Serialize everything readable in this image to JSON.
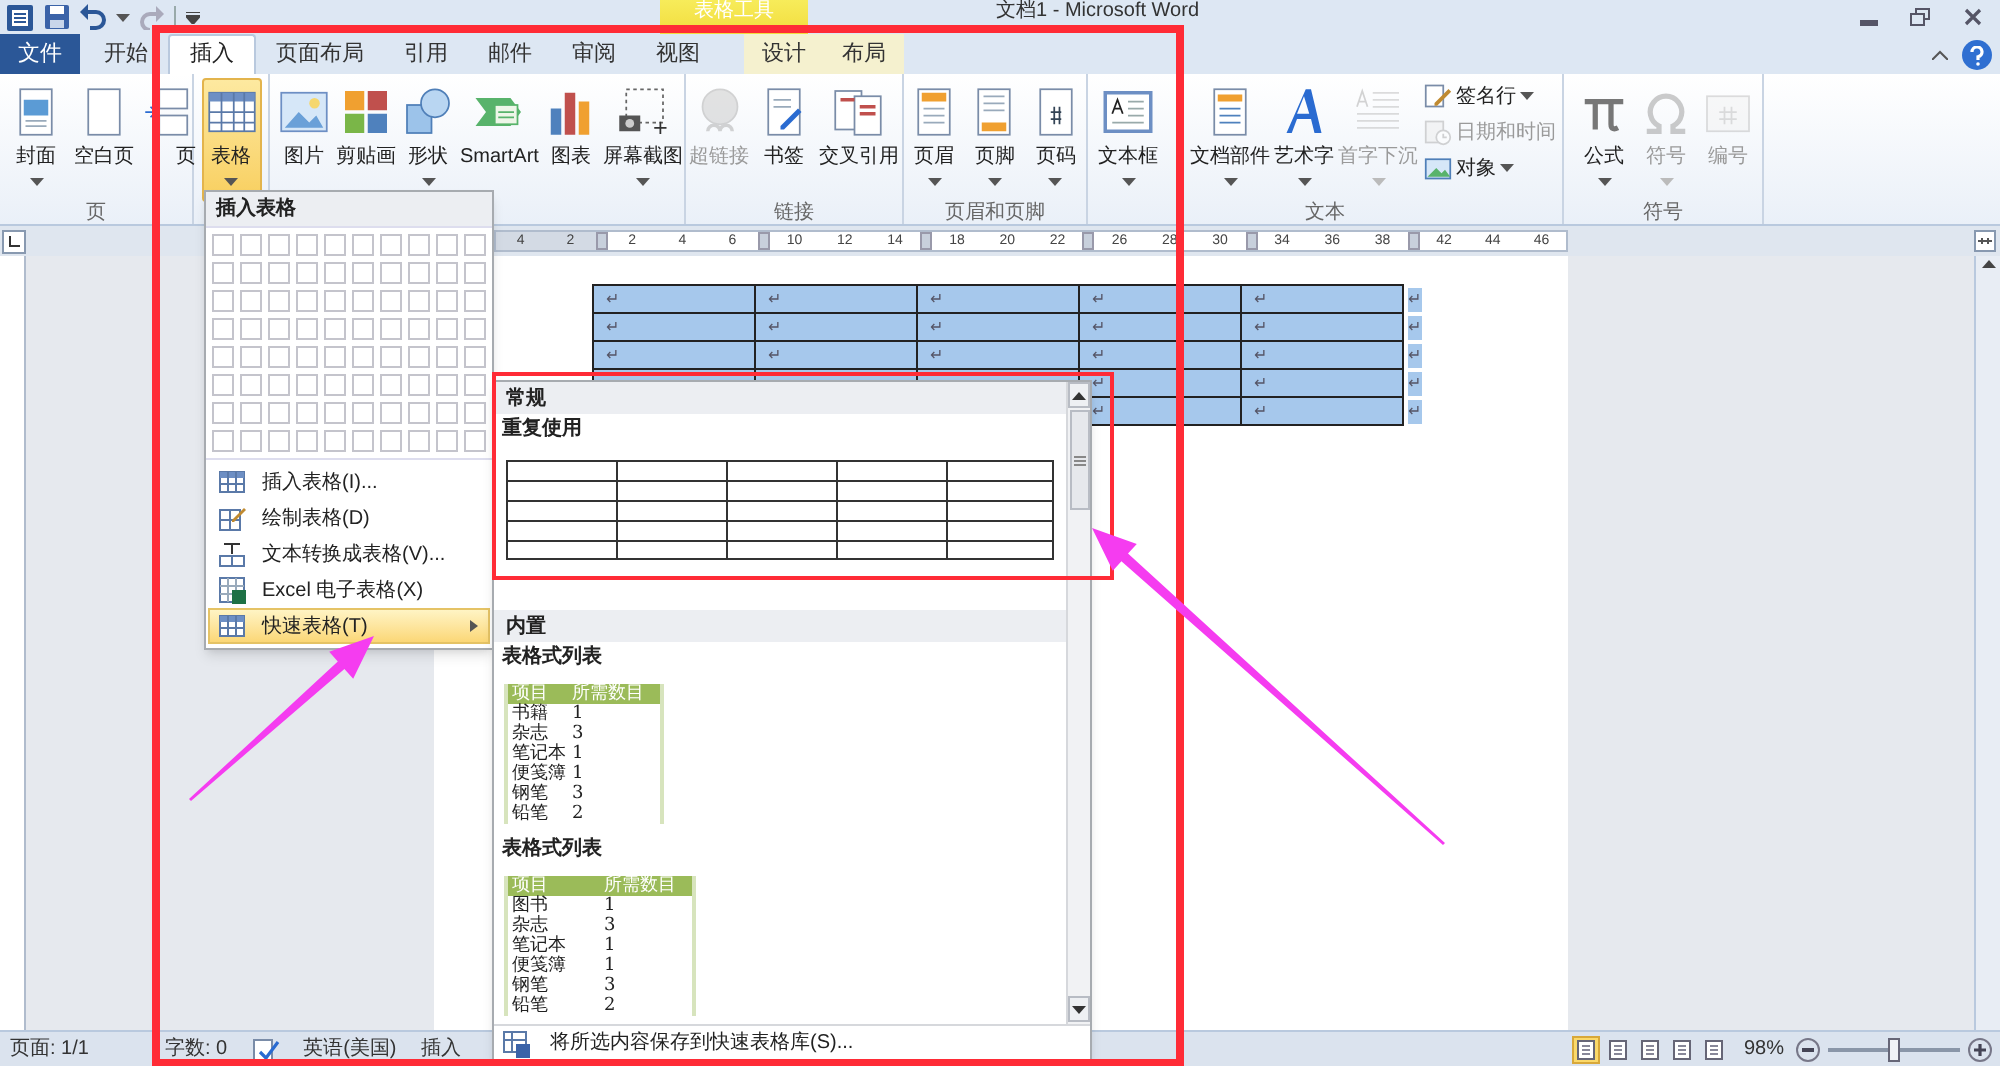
{
  "title_bar": {
    "context_header": "表格工具",
    "title": "文档1 - Microsoft Word"
  },
  "tabs": [
    {
      "label": "文件",
      "kind": "file",
      "selected": false
    },
    {
      "label": "开始",
      "kind": "normal",
      "selected": false
    },
    {
      "label": "插入",
      "kind": "normal",
      "selected": true
    },
    {
      "label": "页面布局",
      "kind": "normal",
      "selected": false
    },
    {
      "label": "引用",
      "kind": "normal",
      "selected": false
    },
    {
      "label": "邮件",
      "kind": "normal",
      "selected": false
    },
    {
      "label": "审阅",
      "kind": "normal",
      "selected": false
    },
    {
      "label": "视图",
      "kind": "normal",
      "selected": false
    },
    {
      "label": "设计",
      "kind": "context",
      "selected": false
    },
    {
      "label": "布局",
      "kind": "context",
      "selected": false
    }
  ],
  "ribbon": {
    "groups": [
      {
        "label": "页",
        "buttons": [
          {
            "label": "封面",
            "kind": "large",
            "has_menu": true,
            "disabled": false,
            "pressed": false
          },
          {
            "label": "空白页",
            "kind": "large",
            "has_menu": false,
            "disabled": false,
            "pressed": false
          },
          {
            "label": "页",
            "kind": "large",
            "has_menu": false,
            "disabled": false,
            "pressed": false
          }
        ]
      },
      {
        "buttons": [
          {
            "label": "表格",
            "kind": "large",
            "has_menu": true,
            "disabled": false,
            "pressed": true
          }
        ]
      },
      {
        "buttons": [
          {
            "label": "图片",
            "kind": "large",
            "has_menu": false,
            "disabled": false,
            "pressed": false
          },
          {
            "label": "剪贴画",
            "kind": "large",
            "has_menu": false,
            "disabled": false,
            "pressed": false
          },
          {
            "label": "形状",
            "kind": "large",
            "has_menu": true,
            "disabled": false,
            "pressed": false
          },
          {
            "label": "SmartArt",
            "kind": "large",
            "has_menu": false,
            "disabled": false,
            "pressed": false
          },
          {
            "label": "图表",
            "kind": "large",
            "has_menu": false,
            "disabled": false,
            "pressed": false
          },
          {
            "label": "屏幕截图",
            "kind": "large",
            "has_menu": true,
            "disabled": false,
            "pressed": false
          }
        ]
      },
      {
        "label": "链接",
        "buttons": [
          {
            "label": "超链接",
            "kind": "large",
            "has_menu": false,
            "disabled": true,
            "pressed": false
          },
          {
            "label": "书签",
            "kind": "large",
            "has_menu": false,
            "disabled": false,
            "pressed": false
          },
          {
            "label": "交叉引用",
            "kind": "large",
            "has_menu": false,
            "disabled": false,
            "pressed": false
          }
        ]
      },
      {
        "label": "页眉和页脚",
        "buttons": [
          {
            "label": "页眉",
            "kind": "large",
            "has_menu": true,
            "disabled": false,
            "pressed": false
          },
          {
            "label": "页脚",
            "kind": "large",
            "has_menu": true,
            "disabled": false,
            "pressed": false
          },
          {
            "label": "页码",
            "kind": "large",
            "has_menu": true,
            "disabled": false,
            "pressed": false
          }
        ]
      },
      {
        "label": "文本",
        "buttons": [
          {
            "label": "文本框",
            "kind": "large",
            "has_menu": true,
            "disabled": false,
            "pressed": false
          },
          {
            "label": "文档部件",
            "kind": "large",
            "has_menu": true,
            "disabled": false,
            "pressed": false
          },
          {
            "label": "艺术字",
            "kind": "large",
            "has_menu": true,
            "disabled": false,
            "pressed": false
          },
          {
            "label": "首字下沉",
            "kind": "large",
            "has_menu": true,
            "disabled": true,
            "pressed": false
          },
          {
            "label": "签名行",
            "kind": "small",
            "has_menu": true,
            "disabled": false,
            "pressed": false
          },
          {
            "label": "日期和时间",
            "kind": "small",
            "has_menu": false,
            "disabled": true,
            "pressed": false
          },
          {
            "label": "对象",
            "kind": "small",
            "has_menu": true,
            "disabled": false,
            "pressed": false
          }
        ]
      },
      {
        "label": "符号",
        "buttons": [
          {
            "label": "公式",
            "kind": "large",
            "has_menu": true,
            "disabled": false,
            "pressed": false
          },
          {
            "label": "符号",
            "kind": "large",
            "has_menu": true,
            "disabled": true,
            "pressed": false
          },
          {
            "label": "编号",
            "kind": "large",
            "has_menu": false,
            "disabled": true,
            "pressed": false
          }
        ]
      }
    ]
  },
  "ruler": {
    "segments": [
      {
        "labels": [
          "4",
          "2"
        ]
      },
      {
        "labels": [
          "2",
          "4",
          "6"
        ]
      },
      {
        "labels": [
          "10",
          "12",
          "14"
        ]
      },
      {
        "labels": [
          "18",
          "20",
          "22"
        ]
      },
      {
        "labels": [
          "26",
          "28",
          "30"
        ]
      },
      {
        "labels": [
          "34",
          "36",
          "38"
        ]
      },
      {
        "labels": [
          "42",
          "44",
          "46"
        ]
      }
    ]
  },
  "document_table": {
    "rows": [
      {
        "selected": true,
        "cells": [
          "↵",
          "↵",
          "↵",
          "↵",
          "↵"
        ],
        "end": "↵"
      },
      {
        "selected": true,
        "cells": [
          "↵",
          "↵",
          "↵",
          "↵",
          "↵"
        ],
        "end": "↵"
      },
      {
        "selected": true,
        "cells": [
          "↵",
          "↵",
          "↵",
          "↵",
          "↵"
        ],
        "end": "↵"
      },
      {
        "selected": true,
        "cells": [
          "↵",
          "↵"
        ],
        "end": "↵"
      },
      {
        "selected": true,
        "cells": [
          "↵",
          "↵"
        ],
        "end": "↵"
      }
    ]
  },
  "table_menu": {
    "header": "插入表格",
    "items": [
      {
        "label": "插入表格(I)...",
        "highlighted": false,
        "has_submenu": false
      },
      {
        "label": "绘制表格(D)",
        "highlighted": false,
        "has_submenu": false
      },
      {
        "label": "文本转换成表格(V)...",
        "highlighted": false,
        "has_submenu": false
      },
      {
        "label": "Excel 电子表格(X)",
        "highlighted": false,
        "has_submenu": false
      },
      {
        "label": "快速表格(T)",
        "highlighted": true,
        "has_submenu": true
      }
    ]
  },
  "quick_tables": {
    "sections": [
      {
        "header": "常规",
        "entries": [
          {
            "kind": "grid",
            "label": "重复使用"
          }
        ]
      },
      {
        "header": "内置",
        "entries": [
          {
            "kind": "list",
            "label": "表格式列表",
            "columns": [
              "项目",
              "所需数目"
            ],
            "rows": [
              [
                "书籍",
                "1"
              ],
              [
                "杂志",
                "3"
              ],
              [
                "笔记本",
                "1"
              ],
              [
                "便笺簿",
                "1"
              ],
              [
                "钢笔",
                "3"
              ],
              [
                "铅笔",
                "2"
              ]
            ]
          },
          {
            "kind": "list",
            "label": "表格式列表",
            "columns": [
              "项目",
              "所需数目"
            ],
            "rows": [
              [
                "图书",
                "1"
              ],
              [
                "杂志",
                "3"
              ],
              [
                "笔记本",
                "1"
              ],
              [
                "便笺簿",
                "1"
              ],
              [
                "钢笔",
                "3"
              ],
              [
                "铅笔",
                "2"
              ]
            ]
          }
        ]
      }
    ],
    "footer": "将所选内容保存到快速表格库(S)..."
  },
  "status_bar": {
    "items": [
      {
        "kind": "text",
        "label": "页面: 1/1"
      },
      {
        "kind": "text",
        "label": "字数: 0"
      },
      {
        "kind": "proofing"
      },
      {
        "kind": "text",
        "label": "英语(美国)"
      },
      {
        "kind": "text",
        "label": "插入"
      }
    ],
    "views": [
      {
        "selected": true
      },
      {
        "selected": false
      },
      {
        "selected": false
      },
      {
        "selected": false
      },
      {
        "selected": false
      }
    ],
    "zoom": "98%",
    "level": 0.5
  },
  "annotations": [
    {
      "kind": "frame"
    },
    {
      "kind": "frame"
    },
    {
      "kind": "arrow"
    },
    {
      "kind": "arrow"
    }
  ]
}
